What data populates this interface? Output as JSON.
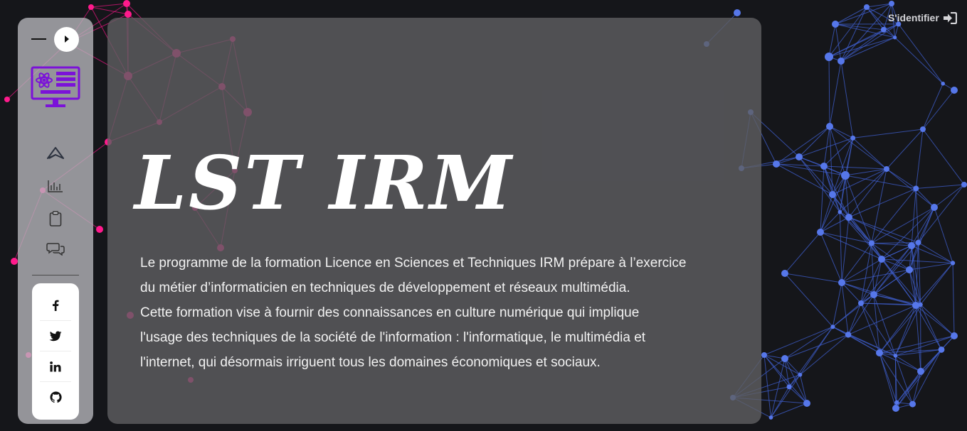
{
  "header": {
    "login_label": "S'identifier",
    "login_icon": "sign-in-icon"
  },
  "sidebar": {
    "toggle_icon": "play-icon",
    "logo_icon": "science-computer-logo-icon",
    "logo_color": "#7b12d8",
    "nav": [
      {
        "icon": "paper-plane-icon"
      },
      {
        "icon": "bar-chart-icon"
      },
      {
        "icon": "clipboard-icon"
      },
      {
        "icon": "chat-bubbles-icon"
      }
    ],
    "social": [
      {
        "icon": "facebook-icon"
      },
      {
        "icon": "twitter-icon"
      },
      {
        "icon": "linkedin-icon"
      },
      {
        "icon": "github-icon"
      }
    ]
  },
  "main": {
    "title": "LST IRM",
    "description_lines": [
      "Le programme de la formation Licence en Sciences et Techniques IRM prépare à l’exercice",
      "du métier d’informaticien en techniques de développement et réseaux multimédia.",
      "Cette formation vise à fournir des connaissances en culture numérique qui implique",
      "l'usage des techniques de la société de l'information : l'informatique, le multimédia et",
      "l'internet, qui désormais irriguent tous les domaines économiques et sociaux."
    ]
  },
  "colors": {
    "background": "#15161a",
    "network_pink": "#ff1a8c",
    "network_blue": "#4f6ee0"
  }
}
